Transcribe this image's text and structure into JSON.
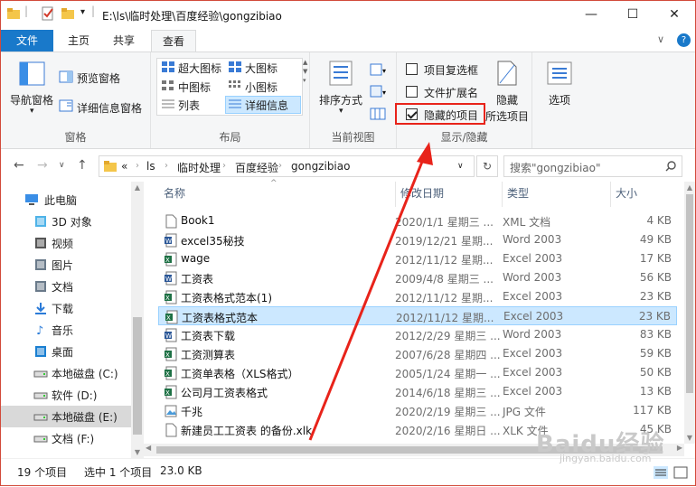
{
  "window": {
    "title": "E:\\ls\\临时处理\\百度经验\\gongzibiao",
    "minimize": "—",
    "maximize": "☐",
    "close": "✕",
    "help": "?",
    "collapse": "∨"
  },
  "tabs": [
    "文件",
    "主页",
    "共享",
    "查看"
  ],
  "ribbon": {
    "pane": {
      "nav_pane": "导航窗格",
      "preview_pane": "预览窗格",
      "details_pane": "详细信息窗格",
      "label": "窗格"
    },
    "layout": {
      "items": [
        "超大图标",
        "大图标",
        "中图标",
        "小图标",
        "列表",
        "详细信息"
      ],
      "label": "布局"
    },
    "current_view": {
      "sort": "排序方式",
      "label": "当前视图"
    },
    "show_hide": {
      "item_checkboxes": "项目复选框",
      "file_extensions": "文件扩展名",
      "hidden_items": "隐藏的项目",
      "hide_selected_1": "隐藏",
      "hide_selected_2": "所选项目",
      "label": "显示/隐藏"
    },
    "options": "选项"
  },
  "address": {
    "crumbs": [
      "«",
      "ls",
      "临时处理",
      "百度经验",
      "gongzibiao"
    ],
    "search_placeholder": "搜索\"gongzibiao\""
  },
  "sidebar": [
    {
      "label": "此电脑",
      "icon": "pc-icon",
      "color": "#3a8ee6"
    },
    {
      "label": "3D 对象",
      "icon": "3d-objects-icon",
      "color": "#4fb3e8"
    },
    {
      "label": "视频",
      "icon": "video-icon",
      "color": "#555"
    },
    {
      "label": "图片",
      "icon": "pictures-icon",
      "color": "#6a7a8a"
    },
    {
      "label": "文档",
      "icon": "documents-icon",
      "color": "#6a7a8a"
    },
    {
      "label": "下载",
      "icon": "download-icon",
      "color": "#2b7bd8"
    },
    {
      "label": "音乐",
      "icon": "music-icon",
      "color": "#2b7bd8"
    },
    {
      "label": "桌面",
      "icon": "desktop-icon",
      "color": "#1a7fd1"
    },
    {
      "label": "本地磁盘 (C:)",
      "icon": "drive-icon",
      "color": "#666"
    },
    {
      "label": "软件 (D:)",
      "icon": "drive-icon",
      "color": "#666"
    },
    {
      "label": "本地磁盘 (E:)",
      "icon": "drive-icon",
      "color": "#666"
    },
    {
      "label": "文档 (F:)",
      "icon": "drive-icon",
      "color": "#666"
    }
  ],
  "columns": [
    "名称",
    "修改日期",
    "类型",
    "大小"
  ],
  "files": [
    {
      "name": "Book1",
      "date": "2020/1/1 星期三 ...",
      "type": "XML 文档",
      "size": "4 KB",
      "icon": "doc"
    },
    {
      "name": "excel35秘技",
      "date": "2019/12/21 星期...",
      "type": "Word 2003",
      "size": "49 KB",
      "icon": "word"
    },
    {
      "name": "wage",
      "date": "2012/11/12 星期...",
      "type": "Excel 2003",
      "size": "17 KB",
      "icon": "excel"
    },
    {
      "name": "工资表",
      "date": "2009/4/8 星期三 ...",
      "type": "Word 2003",
      "size": "56 KB",
      "icon": "word"
    },
    {
      "name": "工资表格式范本(1)",
      "date": "2012/11/12 星期...",
      "type": "Excel 2003",
      "size": "23 KB",
      "icon": "excel"
    },
    {
      "name": "工资表格式范本",
      "date": "2012/11/12 星期...",
      "type": "Excel 2003",
      "size": "23 KB",
      "icon": "excel"
    },
    {
      "name": "工资表下载",
      "date": "2012/2/29 星期三 ...",
      "type": "Word 2003",
      "size": "83 KB",
      "icon": "word"
    },
    {
      "name": "工资测算表",
      "date": "2007/6/28 星期四 ...",
      "type": "Excel 2003",
      "size": "59 KB",
      "icon": "excel"
    },
    {
      "name": "工资单表格（XLS格式）",
      "date": "2005/1/24 星期一 ...",
      "type": "Excel 2003",
      "size": "50 KB",
      "icon": "excel"
    },
    {
      "name": "公司月工资表格式",
      "date": "2014/6/18 星期三 ...",
      "type": "Excel 2003",
      "size": "13 KB",
      "icon": "excel"
    },
    {
      "name": "千兆",
      "date": "2020/2/19 星期三 ...",
      "type": "JPG 文件",
      "size": "117 KB",
      "icon": "image"
    },
    {
      "name": "新建员工工资表 的备份.xlk",
      "date": "2020/2/16 星期日 ...",
      "type": "XLK 文件",
      "size": "45 KB",
      "icon": "doc"
    }
  ],
  "status": {
    "count": "19 个项目",
    "selected": "选中 1 个项目",
    "size": "23.0 KB"
  },
  "watermark": {
    "brand": "Baidu经验",
    "url": "jingyan.baidu.com"
  },
  "colors": {
    "accent": "#1979ca",
    "highlight": "#e8231a",
    "selection": "#cce8ff"
  }
}
